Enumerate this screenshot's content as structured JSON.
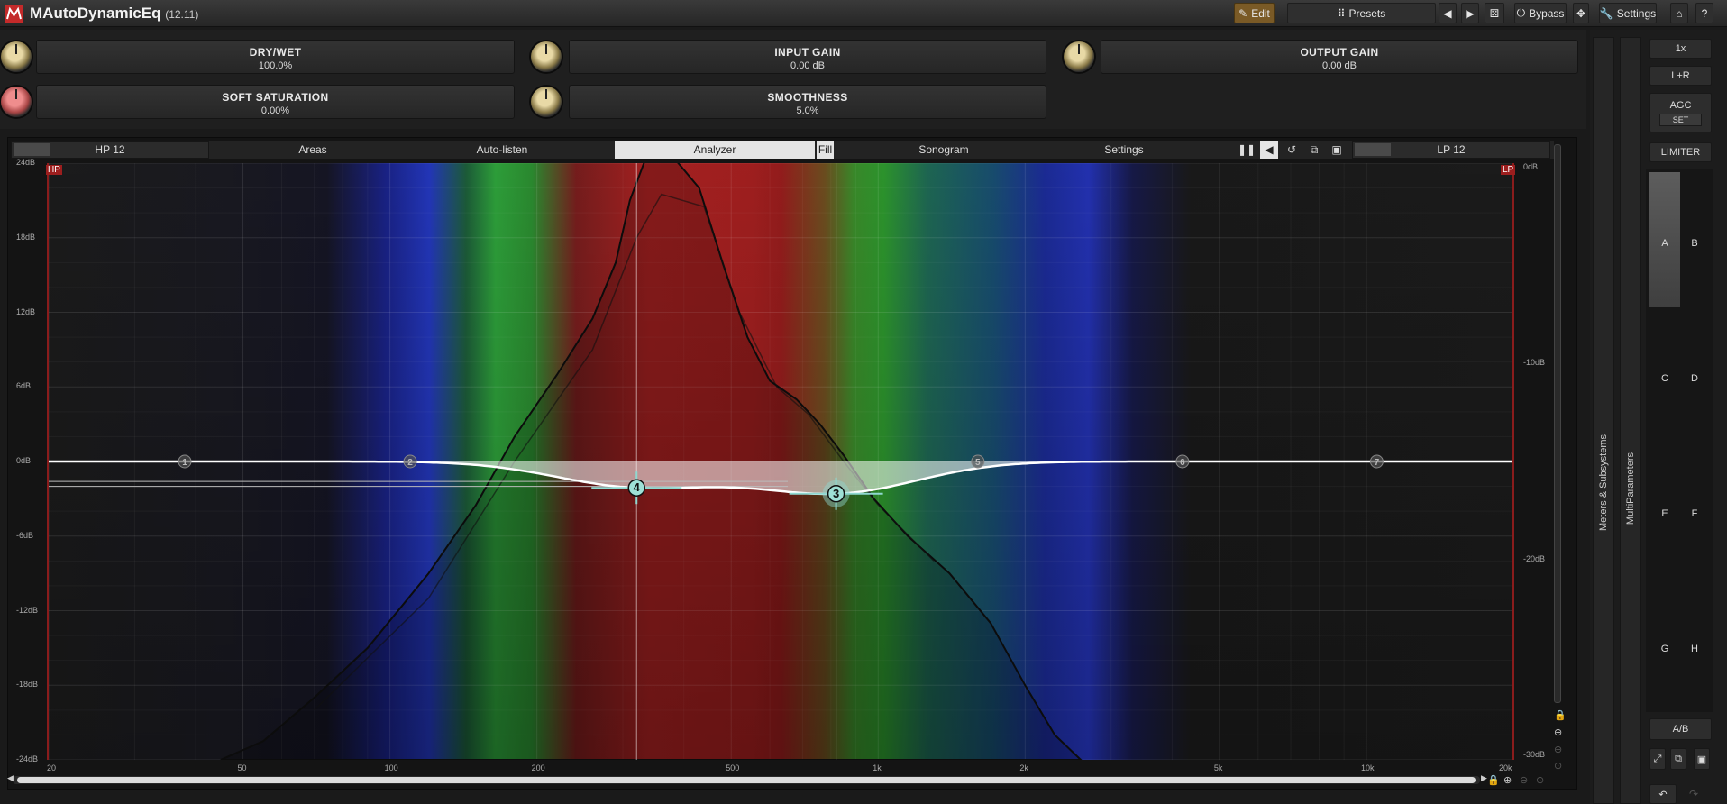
{
  "app": {
    "title": "MAutoDynamicEq",
    "version": "(12.11)"
  },
  "toolbar": {
    "edit": "Edit",
    "presets": "Presets",
    "bypass": "Bypass",
    "settings": "Settings"
  },
  "params": {
    "dry_wet": {
      "label": "DRY/WET",
      "value": "100.0%"
    },
    "input_gain": {
      "label": "INPUT GAIN",
      "value": "0.00 dB"
    },
    "output_gain": {
      "label": "OUTPUT GAIN",
      "value": "0.00 dB"
    },
    "soft_saturation": {
      "label": "SOFT SATURATION",
      "value": "0.00%"
    },
    "smoothness": {
      "label": "SMOOTHNESS",
      "value": "5.0%"
    }
  },
  "eq_tabs": {
    "hp": "HP 12",
    "areas": "Areas",
    "autolisten": "Auto-listen",
    "analyzer": "Analyzer",
    "fill": "Fill",
    "sonogram": "Sonogram",
    "settings": "Settings",
    "lp": "LP 12"
  },
  "graph": {
    "hp_flag": "HP",
    "lp_flag": "LP",
    "y_left": [
      "24dB",
      "18dB",
      "12dB",
      "6dB",
      "0dB",
      "-6dB",
      "-12dB",
      "-18dB",
      "-24dB"
    ],
    "y_right": [
      "0dB",
      "-10dB",
      "-20dB",
      "-30dB"
    ],
    "x_ticks": [
      "20",
      "50",
      "100",
      "200",
      "500",
      "1k",
      "2k",
      "5k",
      "10k",
      "20k"
    ],
    "bands": [
      {
        "n": "1",
        "freq": 38,
        "gain": 0,
        "active": false
      },
      {
        "n": "2",
        "freq": 110,
        "gain": 0,
        "active": false
      },
      {
        "n": "4",
        "freq": 320,
        "gain": -2,
        "active": true
      },
      {
        "n": "3",
        "freq": 820,
        "gain": -2.5,
        "active": true
      },
      {
        "n": "5",
        "freq": 1600,
        "gain": 0,
        "active": false
      },
      {
        "n": "6",
        "freq": 4200,
        "gain": 0,
        "active": false
      },
      {
        "n": "7",
        "freq": 10500,
        "gain": 0,
        "active": false
      }
    ]
  },
  "right": {
    "zoom": "1x",
    "channel": "L+R",
    "agc": "AGC",
    "set": "SET",
    "limiter": "LIMITER",
    "slots": [
      "A",
      "B",
      "C",
      "D",
      "E",
      "F",
      "G",
      "H"
    ],
    "ab": "A/B",
    "meters": "Meters & Subsystems",
    "multiparams": "MultiParameters"
  },
  "colors": {
    "accent": "#b89250",
    "edit_bg": "#7a5a26",
    "curve": "#ffffff",
    "band_node": "#8fd8d0"
  }
}
